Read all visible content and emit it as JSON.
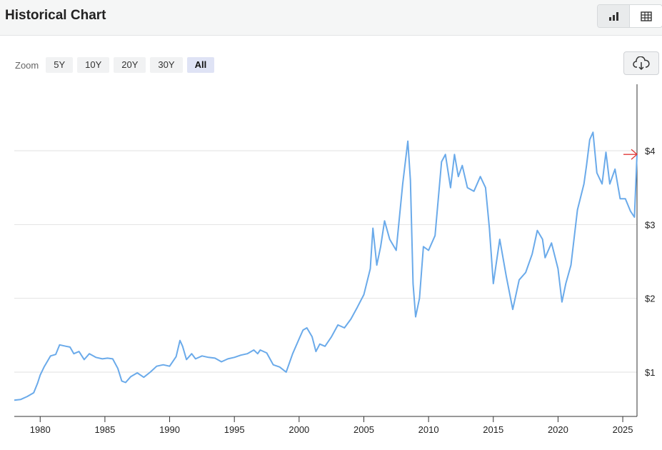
{
  "header": {
    "title": "Historical Chart",
    "chart_view_icon": "bar-chart-icon",
    "table_view_icon": "table-icon"
  },
  "zoom": {
    "label": "Zoom",
    "options": [
      "5Y",
      "10Y",
      "20Y",
      "30Y",
      "All"
    ],
    "selected": "All"
  },
  "download": {
    "icon": "cloud-download-icon"
  },
  "colors": {
    "line": "#6aaaea",
    "marker": "#e03a3a",
    "grid": "#e2e2e2",
    "axis": "#333333"
  },
  "chart_data": {
    "type": "line",
    "title": "",
    "xlabel": "",
    "ylabel": "",
    "xlim": [
      1978,
      2026.1
    ],
    "ylim": [
      0.4,
      4.9
    ],
    "x_ticks": [
      1980,
      1985,
      1990,
      1995,
      2000,
      2005,
      2010,
      2015,
      2020,
      2025
    ],
    "y_ticks": [
      1,
      2,
      3,
      4
    ],
    "y_tick_labels": [
      "$1",
      "$2",
      "$3",
      "$4"
    ],
    "y_axis_side": "right",
    "grid": true,
    "current_value_marker": 3.95,
    "x": [
      1978.0,
      1978.5,
      1979.0,
      1979.5,
      1979.8,
      1980.0,
      1980.3,
      1980.8,
      1981.2,
      1981.5,
      1982.0,
      1982.3,
      1982.6,
      1983.0,
      1983.4,
      1983.8,
      1984.3,
      1984.8,
      1985.2,
      1985.6,
      1986.0,
      1986.3,
      1986.6,
      1987.0,
      1987.5,
      1988.0,
      1988.5,
      1989.0,
      1989.5,
      1990.0,
      1990.5,
      1990.8,
      1991.0,
      1991.3,
      1991.7,
      1992.0,
      1992.5,
      1993.0,
      1993.5,
      1994.0,
      1994.5,
      1995.0,
      1995.5,
      1996.0,
      1996.5,
      1996.8,
      1997.0,
      1997.5,
      1998.0,
      1998.5,
      1999.0,
      1999.5,
      2000.0,
      2000.3,
      2000.6,
      2001.0,
      2001.3,
      2001.6,
      2002.0,
      2002.5,
      2003.0,
      2003.5,
      2004.0,
      2004.5,
      2005.0,
      2005.5,
      2005.7,
      2006.0,
      2006.3,
      2006.6,
      2007.0,
      2007.5,
      2008.0,
      2008.4,
      2008.6,
      2008.8,
      2009.0,
      2009.3,
      2009.6,
      2010.0,
      2010.5,
      2011.0,
      2011.3,
      2011.7,
      2012.0,
      2012.3,
      2012.6,
      2013.0,
      2013.5,
      2014.0,
      2014.4,
      2014.7,
      2015.0,
      2015.5,
      2016.0,
      2016.5,
      2017.0,
      2017.5,
      2018.0,
      2018.4,
      2018.8,
      2019.0,
      2019.5,
      2020.0,
      2020.3,
      2020.6,
      2021.0,
      2021.5,
      2022.0,
      2022.2,
      2022.45,
      2022.7,
      2023.0,
      2023.4,
      2023.7,
      2024.0,
      2024.4,
      2024.8,
      2025.2,
      2025.6,
      2025.9,
      2026.1
    ],
    "y": [
      0.62,
      0.63,
      0.67,
      0.72,
      0.85,
      0.96,
      1.07,
      1.22,
      1.24,
      1.37,
      1.35,
      1.34,
      1.25,
      1.28,
      1.17,
      1.25,
      1.2,
      1.18,
      1.19,
      1.18,
      1.05,
      0.88,
      0.86,
      0.94,
      0.99,
      0.93,
      1.0,
      1.08,
      1.1,
      1.08,
      1.21,
      1.43,
      1.35,
      1.17,
      1.25,
      1.18,
      1.22,
      1.2,
      1.19,
      1.14,
      1.18,
      1.2,
      1.23,
      1.25,
      1.3,
      1.25,
      1.3,
      1.26,
      1.1,
      1.07,
      1.0,
      1.25,
      1.45,
      1.57,
      1.6,
      1.48,
      1.28,
      1.38,
      1.35,
      1.48,
      1.64,
      1.6,
      1.72,
      1.88,
      2.05,
      2.4,
      2.95,
      2.45,
      2.7,
      3.05,
      2.8,
      2.65,
      3.55,
      4.13,
      3.6,
      2.2,
      1.75,
      2.0,
      2.7,
      2.65,
      2.85,
      3.85,
      3.95,
      3.5,
      3.95,
      3.65,
      3.8,
      3.5,
      3.45,
      3.65,
      3.5,
      2.95,
      2.2,
      2.8,
      2.3,
      1.85,
      2.25,
      2.35,
      2.6,
      2.92,
      2.8,
      2.55,
      2.75,
      2.4,
      1.95,
      2.2,
      2.45,
      3.2,
      3.55,
      3.8,
      4.15,
      4.25,
      3.7,
      3.55,
      3.98,
      3.55,
      3.75,
      3.35,
      3.35,
      3.18,
      3.1,
      3.95
    ]
  }
}
